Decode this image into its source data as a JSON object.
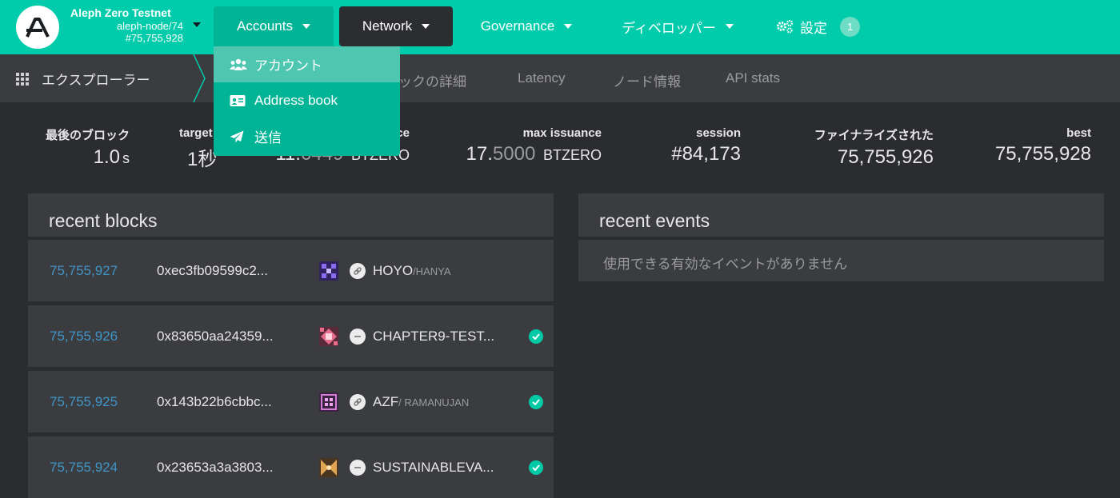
{
  "header": {
    "chain_name": "Aleph Zero Testnet",
    "node": "aleph-node/74",
    "block": "#75,755,928",
    "menus": {
      "accounts": "Accounts",
      "network": "Network",
      "governance": "Governance",
      "developer": "ディベロッパー",
      "settings": "設定",
      "settings_badge": "1"
    },
    "colors": {
      "bar": "#00ccab",
      "accent": "#02b496"
    }
  },
  "dropdown": {
    "items": [
      {
        "label": "アカウント",
        "icon": "users-icon"
      },
      {
        "label": "Address book",
        "icon": "id-card-icon"
      },
      {
        "label": "送信",
        "icon": "paper-plane-icon"
      }
    ]
  },
  "subnav": {
    "explorer": "エクスプローラー",
    "tabs": [
      "ックの詳細",
      "Latency",
      "ノード情報",
      "API stats"
    ]
  },
  "summary": {
    "last_block": {
      "label": "最後のブロック",
      "value": "1.0",
      "unit": "s"
    },
    "target": {
      "label": "target",
      "value": "1秒"
    },
    "issuance": {
      "label": "ce",
      "value_int": "11.",
      "value_dec": "6449",
      "unit": "BTZERO"
    },
    "max_issuance": {
      "label": "max issuance",
      "value_int": "17.",
      "value_dec": "5000",
      "unit": "BTZERO"
    },
    "session": {
      "label": "session",
      "value": "#84,173"
    },
    "finalized": {
      "label": "ファイナライズされた",
      "value": "75,755,926"
    },
    "best": {
      "label": "best",
      "value": "75,755,928"
    }
  },
  "recent_blocks": {
    "title": "recent blocks",
    "rows": [
      {
        "number": "75,755,927",
        "hash": "0xec3fb09599c2...",
        "author": "HOYO",
        "author_sub": "/HANYA",
        "finalized": false,
        "ident_color": "#6b4fd8"
      },
      {
        "number": "75,755,926",
        "hash": "0x83650aa24359...",
        "author": "CHAPTER9-TEST...",
        "author_sub": "",
        "finalized": true,
        "ident_color": "#d2476a"
      },
      {
        "number": "75,755,925",
        "hash": "0x143b22b6cbbc...",
        "author": "AZF",
        "author_sub": "/ RAMANUJAN",
        "finalized": true,
        "ident_color": "#c25fc4"
      },
      {
        "number": "75,755,924",
        "hash": "0x23653a3a3803...",
        "author": "SUSTAINABLEVA...",
        "author_sub": "",
        "finalized": true,
        "ident_color": "#c7883a"
      }
    ]
  },
  "recent_events": {
    "title": "recent events",
    "empty": "使用できる有効なイベントがありません"
  }
}
